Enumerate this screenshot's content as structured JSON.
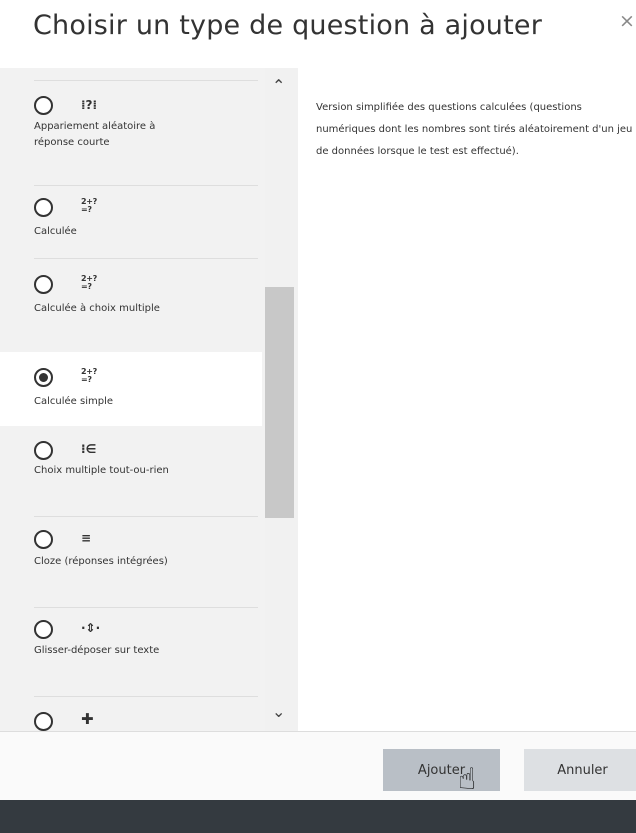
{
  "dialog": {
    "title": "Choisir un type de question à ajouter",
    "close_glyph": "×"
  },
  "options": [
    {
      "id": "randomsamatch",
      "icon_glyph": "⁞?⁞",
      "icon_name": "random-match-icon",
      "label": "Appariement aléatoire à réponse courte",
      "selected": false
    },
    {
      "id": "calculated",
      "icon_glyph": "2+?\n=?",
      "icon_name": "calculated-icon",
      "label": "Calculée",
      "selected": false
    },
    {
      "id": "calculatedmulti",
      "icon_glyph": "2+?\n=?",
      "icon_name": "calculated-multi-icon",
      "label": "Calculée à choix multiple",
      "selected": false
    },
    {
      "id": "calculatedsimple",
      "icon_glyph": "2+?\n=?",
      "icon_name": "calculated-simple-icon",
      "label": "Calculée simple",
      "selected": true
    },
    {
      "id": "multichoiceset",
      "icon_glyph": "⁝∈",
      "icon_name": "multichoice-set-icon",
      "label": "Choix multiple tout-ou-rien",
      "selected": false
    },
    {
      "id": "multianswer",
      "icon_glyph": "≡",
      "icon_name": "cloze-icon",
      "label": "Cloze (réponses intégrées)",
      "selected": false
    },
    {
      "id": "ddwtos",
      "icon_glyph": "·⇕·",
      "icon_name": "drag-drop-text-icon",
      "label": "Glisser-déposer sur texte",
      "selected": false
    },
    {
      "id": "ddimageortext",
      "icon_glyph": "✚",
      "icon_name": "drag-drop-image-icon",
      "label": "",
      "selected": false
    }
  ],
  "description": "Version simplifiée des questions calculées (questions numériques dont les nombres sont tirés aléatoirement d'un jeu de données lorsque le test est effectué).",
  "buttons": {
    "add": "Ajouter",
    "cancel": "Annuler"
  },
  "scroll": {
    "up_glyph": "⌃",
    "down_glyph": "⌄"
  }
}
